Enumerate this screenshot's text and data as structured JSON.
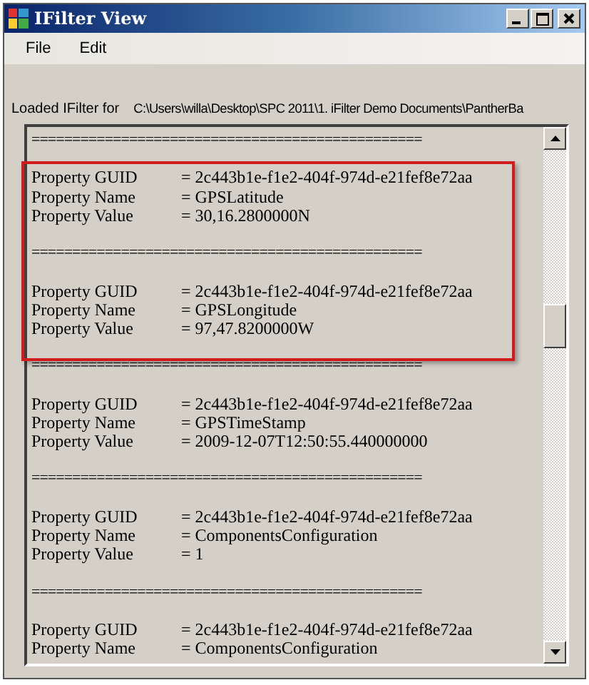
{
  "window": {
    "title": "IFilter View"
  },
  "menu": [
    "File",
    "Edit"
  ],
  "loaded_label": "Loaded IFilter for",
  "file_path": "C:\\Users\\willa\\Desktop\\SPC 2011\\1. iFilter Demo Documents\\PantherBa",
  "output_lines": [
    {
      "kind": "separator",
      "text": "================================================"
    },
    {
      "kind": "blank"
    },
    {
      "kind": "property",
      "label": "Property GUID",
      "value": "= 2c443b1e-f1e2-404f-974d-e21fef8e72aa"
    },
    {
      "kind": "property",
      "label": "Property Name",
      "value": "= GPSLatitude"
    },
    {
      "kind": "property",
      "label": "Property Value",
      "value": "= 30,16.2800000N"
    },
    {
      "kind": "blank"
    },
    {
      "kind": "separator",
      "text": "================================================"
    },
    {
      "kind": "blank"
    },
    {
      "kind": "property",
      "label": "Property GUID",
      "value": "= 2c443b1e-f1e2-404f-974d-e21fef8e72aa"
    },
    {
      "kind": "property",
      "label": "Property Name",
      "value": "= GPSLongitude"
    },
    {
      "kind": "property",
      "label": "Property Value",
      "value": "= 97,47.8200000W"
    },
    {
      "kind": "blank"
    },
    {
      "kind": "separator",
      "text": "================================================"
    },
    {
      "kind": "blank"
    },
    {
      "kind": "property",
      "label": "Property GUID",
      "value": "= 2c443b1e-f1e2-404f-974d-e21fef8e72aa"
    },
    {
      "kind": "property",
      "label": "Property Name",
      "value": "= GPSTimeStamp"
    },
    {
      "kind": "property",
      "label": "Property Value",
      "value": "= 2009-12-07T12:50:55.440000000"
    },
    {
      "kind": "blank"
    },
    {
      "kind": "separator",
      "text": "================================================"
    },
    {
      "kind": "blank"
    },
    {
      "kind": "property",
      "label": "Property GUID",
      "value": "= 2c443b1e-f1e2-404f-974d-e21fef8e72aa"
    },
    {
      "kind": "property",
      "label": "Property Name",
      "value": "= ComponentsConfiguration"
    },
    {
      "kind": "property",
      "label": "Property Value",
      "value": "= 1"
    },
    {
      "kind": "blank"
    },
    {
      "kind": "separator",
      "text": "================================================"
    },
    {
      "kind": "blank"
    },
    {
      "kind": "property",
      "label": "Property GUID",
      "value": "= 2c443b1e-f1e2-404f-974d-e21fef8e72aa"
    },
    {
      "kind": "property",
      "label": "Property Name",
      "value": "= ComponentsConfiguration"
    }
  ]
}
